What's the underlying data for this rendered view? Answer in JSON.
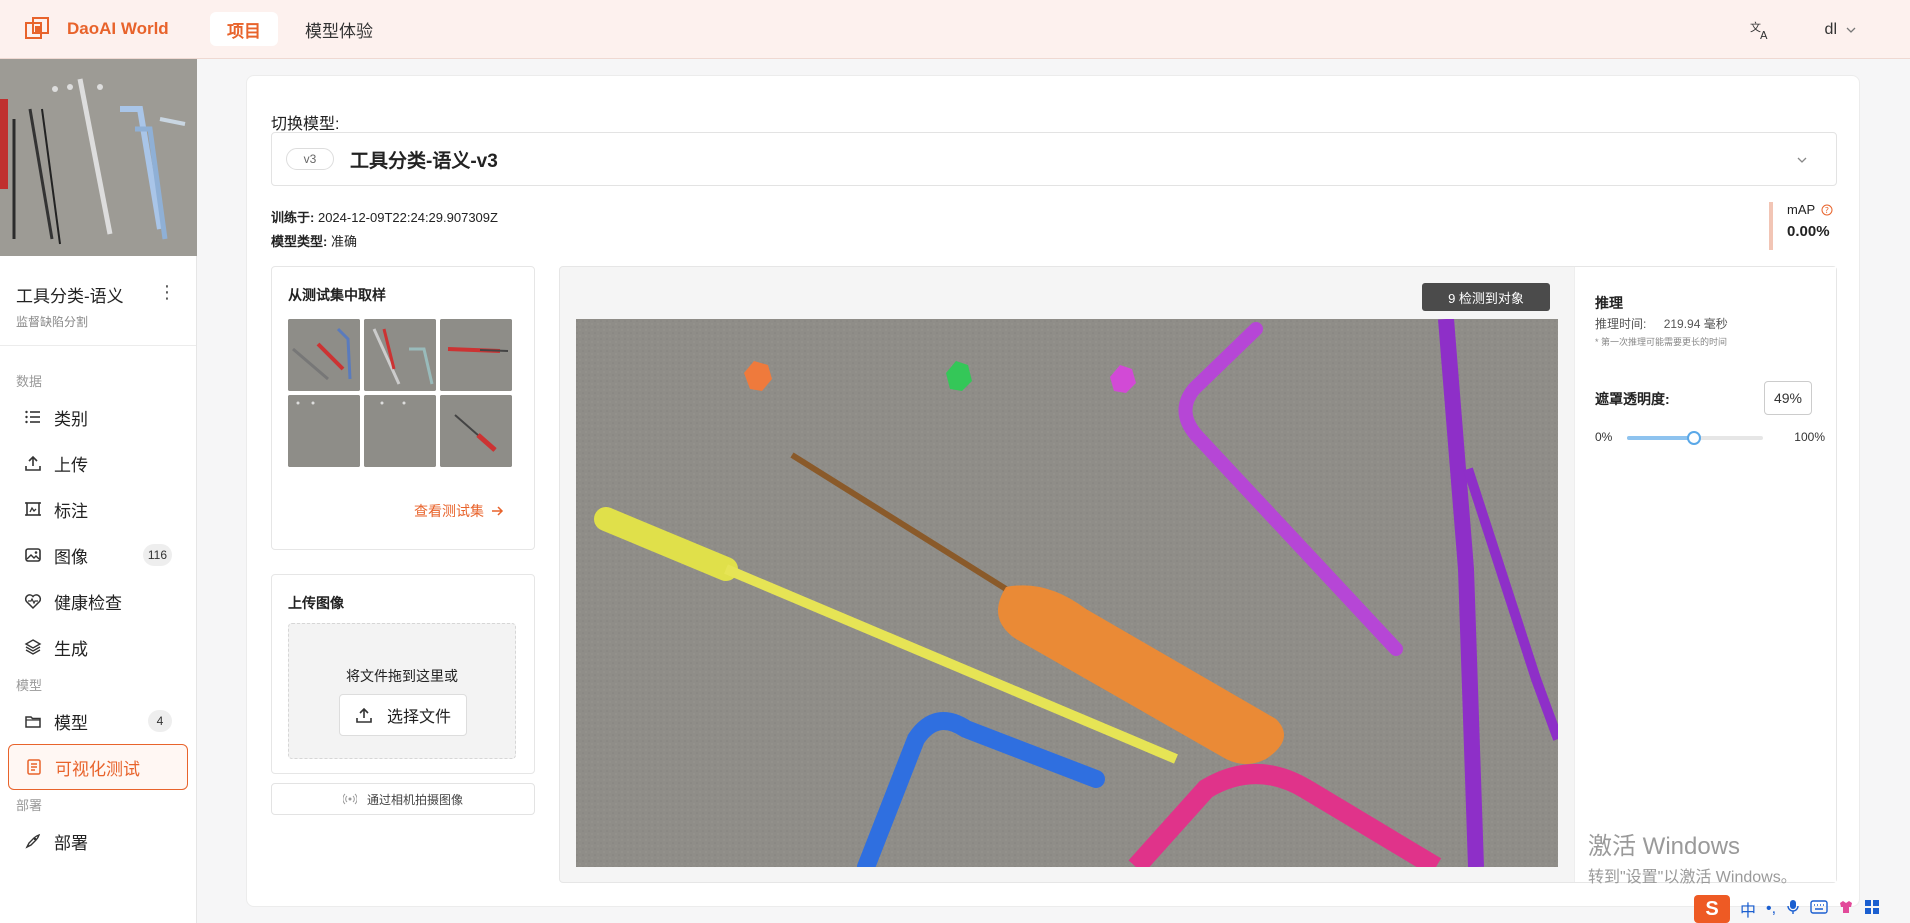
{
  "app": {
    "brand": "DaoAI World"
  },
  "nav": {
    "tabs": [
      {
        "label": "项目"
      },
      {
        "label": "模型体验"
      }
    ]
  },
  "user": {
    "name": "dl"
  },
  "sidebar": {
    "project_title": "工具分类-语义",
    "project_subtitle": "监督缺陷分割",
    "sections": {
      "data": "数据",
      "model": "模型",
      "deploy": "部署"
    },
    "items": [
      {
        "label": "类别",
        "icon": "list-icon"
      },
      {
        "label": "上传",
        "icon": "upload-icon"
      },
      {
        "label": "标注",
        "icon": "annotate-icon"
      },
      {
        "label": "图像",
        "icon": "image-icon",
        "badge": "116"
      },
      {
        "label": "健康检查",
        "icon": "heart-pulse-icon"
      },
      {
        "label": "生成",
        "icon": "layers-icon"
      },
      {
        "label": "模型",
        "icon": "folder-icon",
        "badge": "4"
      },
      {
        "label": "可视化测试",
        "icon": "document-icon"
      },
      {
        "label": "部署",
        "icon": "rocket-icon"
      }
    ]
  },
  "model": {
    "switch_label": "切换模型:",
    "version": "v3",
    "name": "工具分类-语义-v3",
    "trained_label": "训练于:",
    "trained_value": "2024-12-09T22:24:29.907309Z",
    "type_label": "模型类型:",
    "type_value": "准确",
    "map_label": "mAP",
    "map_value": "0.00%"
  },
  "sample": {
    "title": "从测试集中取样",
    "view_link": "查看测试集"
  },
  "upload": {
    "title": "上传图像",
    "drop_text": "将文件拖到这里或",
    "choose_label": "选择文件",
    "camera_label": "通过相机拍摄图像"
  },
  "viewer": {
    "detections": "9 检测到对象"
  },
  "inference": {
    "title": "推理",
    "time_label": "推理时间:",
    "time_value": "219.94 毫秒",
    "note": "* 第一次推理可能需要更长的时间",
    "opacity_label": "遮罩透明度:",
    "opacity_value": "49%",
    "opacity_fraction": 0.49,
    "min_label": "0%",
    "max_label": "100%"
  },
  "watermark": {
    "line1": "激活 Windows",
    "line2": "转到\"设置\"以激活 Windows。"
  },
  "ime": {
    "logo": "S",
    "mode": "中",
    "punct": "•,"
  },
  "colors": {
    "accent": "#e8632b",
    "topbar_bg": "#fdf1ee",
    "slider": "#5aa8e8"
  }
}
